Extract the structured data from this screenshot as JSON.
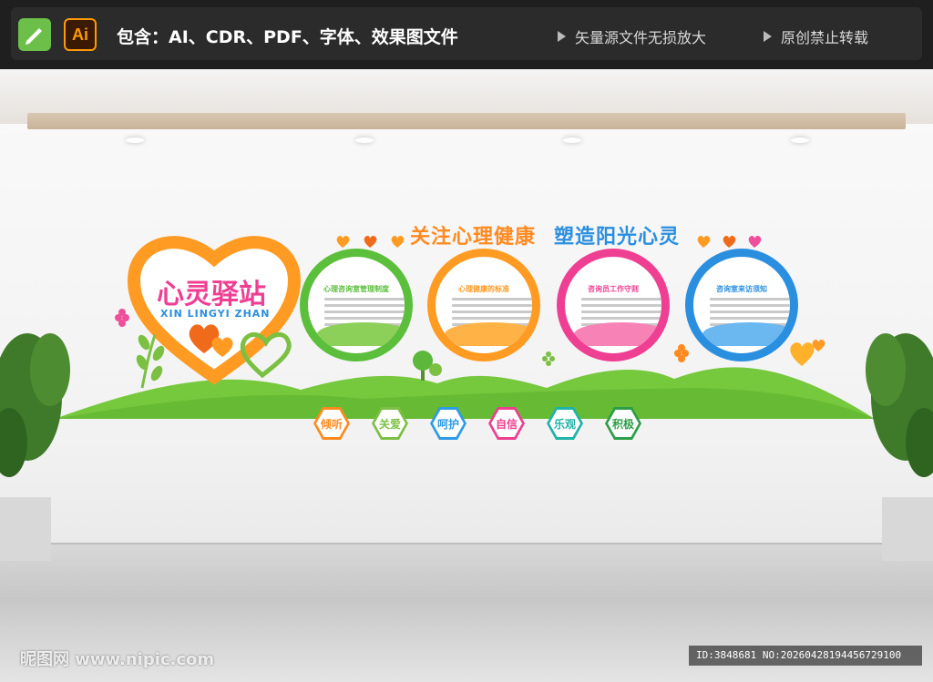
{
  "header": {
    "includes_text": "包含：AI、CDR、PDF、字体、效果图文件",
    "note_vector": "矢量源文件无损放大",
    "note_original": "原创禁止转载",
    "ai_icon_label": "Ai"
  },
  "logo": {
    "title": "心灵驿站",
    "subtitle": "XIN LINGYI ZHAN"
  },
  "slogan": {
    "part1": "关注心理健康",
    "part2": "塑造阳光心灵"
  },
  "panels": [
    {
      "title": "心理咨询室管理制度",
      "color": "#5cbf3c",
      "hill": "#8cd05a"
    },
    {
      "title": "心理健康的标准",
      "color": "#ff9b22",
      "hill": "#ffb347"
    },
    {
      "title": "咨询员工作守则",
      "color": "#ef3f93",
      "hill": "#f783b6"
    },
    {
      "title": "咨询室来访须知",
      "color": "#2b8fe0",
      "hill": "#6bb7f0"
    }
  ],
  "values": [
    {
      "label": "倾听",
      "color": "#ff8a1f"
    },
    {
      "label": "关爱",
      "color": "#7bc043"
    },
    {
      "label": "呵护",
      "color": "#2e9be6"
    },
    {
      "label": "自信",
      "color": "#ec3f8f"
    },
    {
      "label": "乐观",
      "color": "#20b3a8"
    },
    {
      "label": "积极",
      "color": "#2d9e48"
    }
  ],
  "footer": {
    "watermark": "昵图网 www.nipic.com",
    "id_text": "ID:3848681 NO:20260428194456729100"
  },
  "colors": {
    "green": "#66c23a",
    "orange": "#ff9b22",
    "pink": "#ef3f93",
    "blue": "#2b8fe0"
  }
}
